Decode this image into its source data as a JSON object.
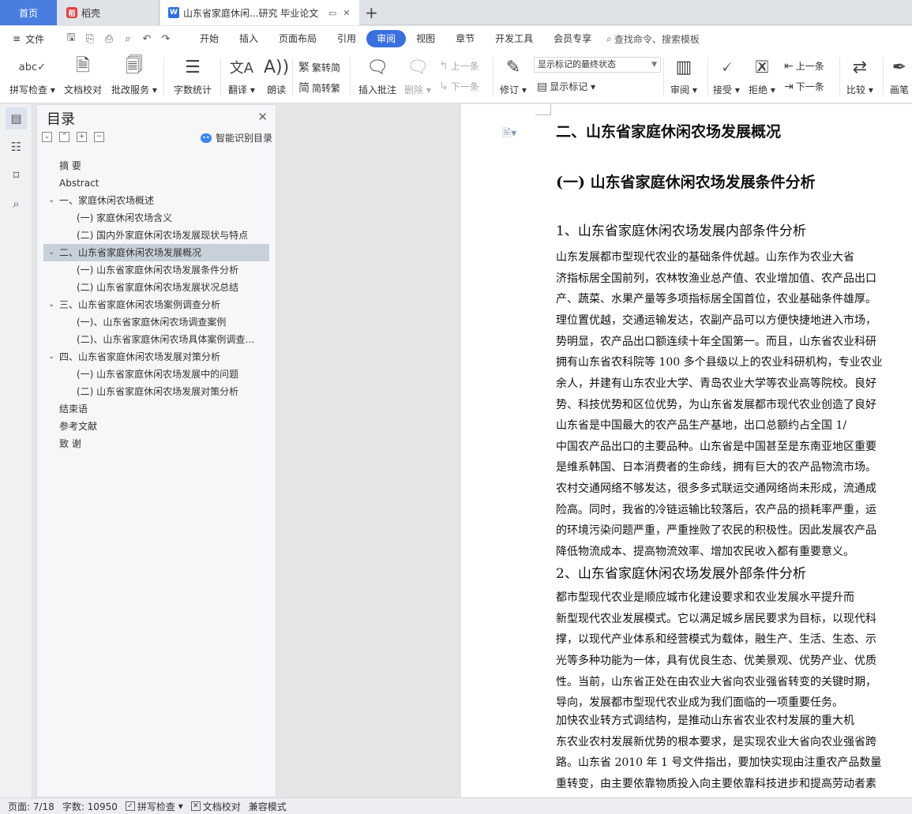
{
  "tabs": {
    "home": "首页",
    "daoke": "稻壳",
    "doc": "山东省家庭休闲...研究 毕业论文"
  },
  "menubar": {
    "file": "文件",
    "items": [
      "开始",
      "插入",
      "页面布局",
      "引用",
      "审阅",
      "视图",
      "章节",
      "开发工具",
      "会员专享"
    ],
    "active": "审阅",
    "search": "查找命令、搜索模板"
  },
  "ribbon": {
    "spellcheck": "拼写检查",
    "doccheck": "文档校对",
    "revise_service": "批改服务",
    "wordcount": "字数统计",
    "translate": "翻译",
    "read": "朗读",
    "trad_simp": "繁转简",
    "simp_trad": "简转繁",
    "insert_comment": "插入批注",
    "delete": "删除",
    "prev_comment": "上一条",
    "next_comment": "下一条",
    "track": "修订",
    "markup_mode": "显示标记的最终状态",
    "show_markup": "显示标记",
    "review": "审阅",
    "accept": "接受",
    "reject": "拒绝",
    "prev_change": "上一条",
    "next_change": "下一条",
    "compare": "比较",
    "pen": "画笔"
  },
  "toc": {
    "title": "目录",
    "smart": "智能识别目录",
    "items": [
      {
        "label": "摘    要",
        "level": 1
      },
      {
        "label": "Abstract",
        "level": 1
      },
      {
        "label": "一、家庭休闲农场概述",
        "level": 1,
        "expanded": true
      },
      {
        "label": "(一) 家庭休闲农场含义",
        "level": 2
      },
      {
        "label": "(二) 国内外家庭休闲农场发展现状与特点",
        "level": 2
      },
      {
        "label": "二、山东省家庭休闲农场发展概况",
        "level": 1,
        "expanded": true,
        "selected": true
      },
      {
        "label": "(一) 山东省家庭休闲农场发展条件分析",
        "level": 2
      },
      {
        "label": "(二) 山东省家庭休闲农场发展状况总结",
        "level": 2
      },
      {
        "label": "三、山东省家庭休闲农场案例调查分析",
        "level": 1,
        "expanded": true
      },
      {
        "label": "(一)、山东省家庭休闲农场调查案例",
        "level": 2
      },
      {
        "label": "(二)、山东省家庭休闲农场具体案例调查…",
        "level": 2
      },
      {
        "label": "四、山东省家庭休闲农场发展对策分析",
        "level": 1,
        "expanded": true
      },
      {
        "label": "(一) 山东省家庭休闲农场发展中的问题",
        "level": 2
      },
      {
        "label": "(二) 山东省家庭休闲农场发展对策分析",
        "level": 2
      },
      {
        "label": "结束语",
        "level": 1
      },
      {
        "label": "参考文献",
        "level": 1
      },
      {
        "label": "致    谢",
        "level": 1
      }
    ]
  },
  "document": {
    "h2": "二、山东省家庭休闲农场发展概况",
    "h3": "(一) 山东省家庭休闲农场发展条件分析",
    "h4_1": "1、山东省家庭休闲农场发展内部条件分析",
    "para1": [
      "    山东发展都市型现代农业的基础条件优越。山东作为农业大省",
      "济指标居全国前列，农林牧渔业总产值、农业增加值、农产品出口",
      "产、蔬菜、水果产量等多项指标居全国首位，农业基础条件雄厚。",
      "理位置优越，交通运输发达，农副产品可以方便快捷地进入市场，",
      "势明显，农产品出口额连续十年全国第一。而且，山东省农业科研",
      "拥有山东省农科院等 100 多个县级以上的农业科研机构，专业农业",
      "余人，并建有山东农业大学、青岛农业大学等农业高等院校。良好",
      "势、科技优势和区位优势，为山东省发展都市现代农业创造了良好"
    ],
    "para2": [
      "    山东省是中国最大的农产品生产基地，出口总额约占全国 1/",
      "中国农产品出口的主要品种。山东省是中国甚至是东南亚地区重要",
      "是维系韩国、日本消费者的生命线，拥有巨大的农产品物流市场。",
      "农村交通网络不够发达，很多多式联运交通网络尚未形成，流通成",
      "险高。同时，我省的冷链运输比较落后，农产品的损耗率严重，运",
      "的环境污染问题严重，严重挫败了农民的积极性。因此发展农产品",
      "降低物流成本、提高物流效率、增加农民收入都有重要意义。"
    ],
    "h4_2": "2、山东省家庭休闲农场发展外部条件分析",
    "para3": [
      "    都市型现代农业是顺应城市化建设要求和农业发展水平提升而",
      "新型现代农业发展模式。它以满足城乡居民要求为目标，以现代科",
      "撑，以现代产业体系和经营模式为载体，融生产、生活、生态、示",
      "光等多种功能为一体，具有优良生态、优美景观、优势产业、优质",
      "性。当前，山东省正处在由农业大省向农业强省转变的关键时期，",
      "导向，发展都市型现代农业成为我们面临的一项重要任务。"
    ],
    "para4": [
      "    加快农业转方式调结构，是推动山东省农业农村发展的重大机",
      "东农业农村发展新优势的根本要求，是实现农业大省向农业强省跨",
      "路。山东省 2010 年 1 号文件指出，要加快实现由注重农产品数量",
      "重转变，由主要依靠物质投入向主要依靠科技进步和提高劳动者素"
    ]
  },
  "status": {
    "page": "页面: 7/18",
    "words": "字数: 10950",
    "spell": "拼写检查",
    "doccheck": "文档校对",
    "compat": "兼容模式"
  }
}
